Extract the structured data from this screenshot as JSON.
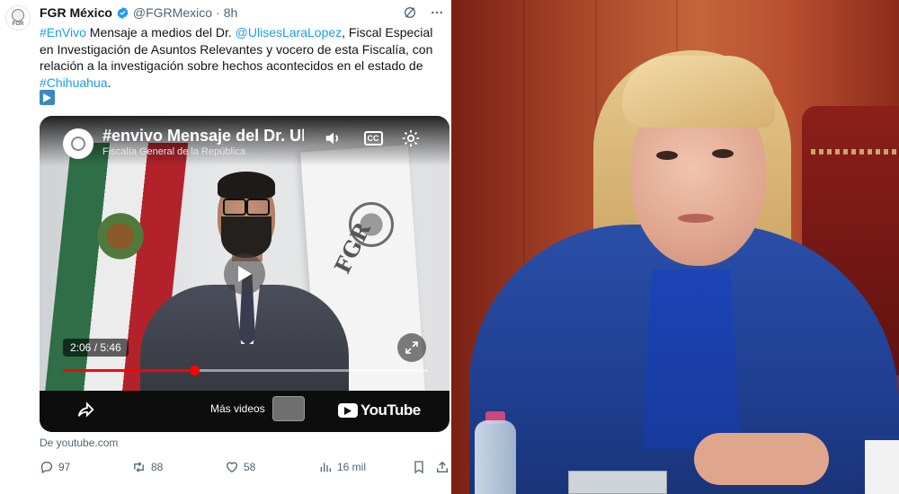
{
  "tweet": {
    "display_name": "FGR México",
    "handle": "@FGRMexico",
    "separator": "·",
    "time": "8h",
    "avatar_text": "FGR",
    "text_parts": [
      {
        "text": "#EnVivo",
        "link": true
      },
      {
        "text": " Mensaje a medios del Dr. ",
        "link": false
      },
      {
        "text": "@UlisesLaraLopez",
        "link": true
      },
      {
        "text": ", Fiscal Especial en Investigación de Asuntos Relevantes y vocero de esta Fiscalía, con relación a la investigación sobre hechos acontecidos en el estado de ",
        "link": false
      },
      {
        "text": "#Chihuahua",
        "link": true
      },
      {
        "text": ".",
        "link": false
      }
    ],
    "emoji_icon": "play-button-emoji",
    "source": "De youtube.com",
    "actions": {
      "replies": "97",
      "retweets": "88",
      "likes": "58",
      "views": "16 mil"
    }
  },
  "video": {
    "title": "#envivo Mensaje del Dr. Ulises L",
    "channel": "Fiscalía General de la República",
    "scene_text": "FGR",
    "time": "2:06 / 5:46",
    "progress": 0.36,
    "more_videos_label": "Más videos",
    "brand": "YouTube",
    "icons": [
      "volume-icon",
      "closed-captions-icon",
      "settings-gear-icon",
      "play-icon",
      "expand-icon",
      "share-icon",
      "youtube-logo-icon"
    ],
    "cc_label": "CC"
  },
  "colors": {
    "link": "#1d9bf0",
    "secondary_text": "#536471",
    "youtube_red": "#ff0000",
    "verified": "#1d9bf0"
  }
}
